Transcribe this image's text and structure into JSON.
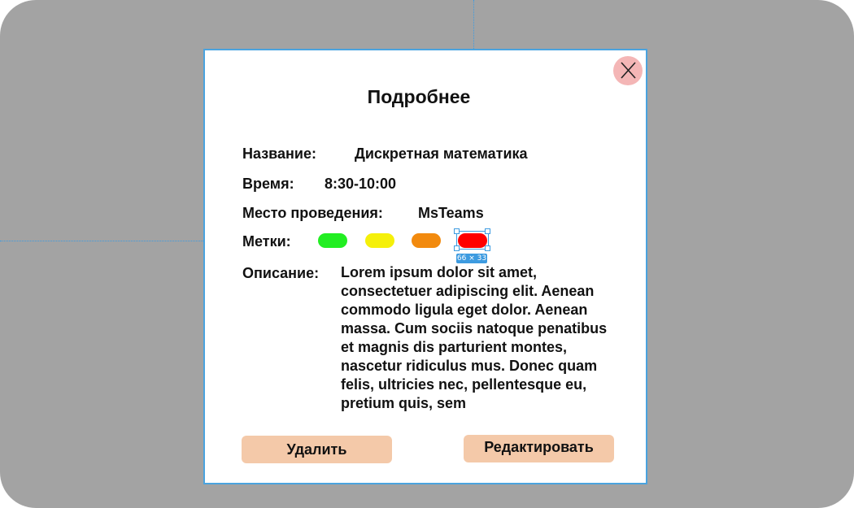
{
  "modal": {
    "title": "Подробнее",
    "fields": {
      "name_label": "Название:",
      "name_value": "Дискретная математика",
      "time_label": "Время:",
      "time_value": "8:30-10:00",
      "place_label": "Место проведения:",
      "place_value": "MsTeams",
      "tags_label": "Метки:",
      "description_label": "Описание:",
      "description_value": "Lorem ipsum dolor sit amet, consectetuer adipiscing elit. Aenean commodo ligula eget dolor. Aenean massa. Cum sociis natoque penatibus et magnis dis parturient montes, nascetur ridiculus mus. Donec quam felis, ultricies nec, pellentesque eu, pretium quis, sem"
    },
    "tags": [
      {
        "color": "#22ee22"
      },
      {
        "color": "#f5f00a"
      },
      {
        "color": "#f28a0e"
      },
      {
        "color": "#ff0000"
      }
    ],
    "selection_size": "66 × 33",
    "buttons": {
      "delete": "Удалить",
      "edit": "Редактировать"
    },
    "close_icon": "close-icon"
  },
  "colors": {
    "backdrop": "#a3a3a3",
    "accent": "#4aa3df",
    "button_bg": "#f4c9a9",
    "close_bg": "#f4b6b6"
  }
}
